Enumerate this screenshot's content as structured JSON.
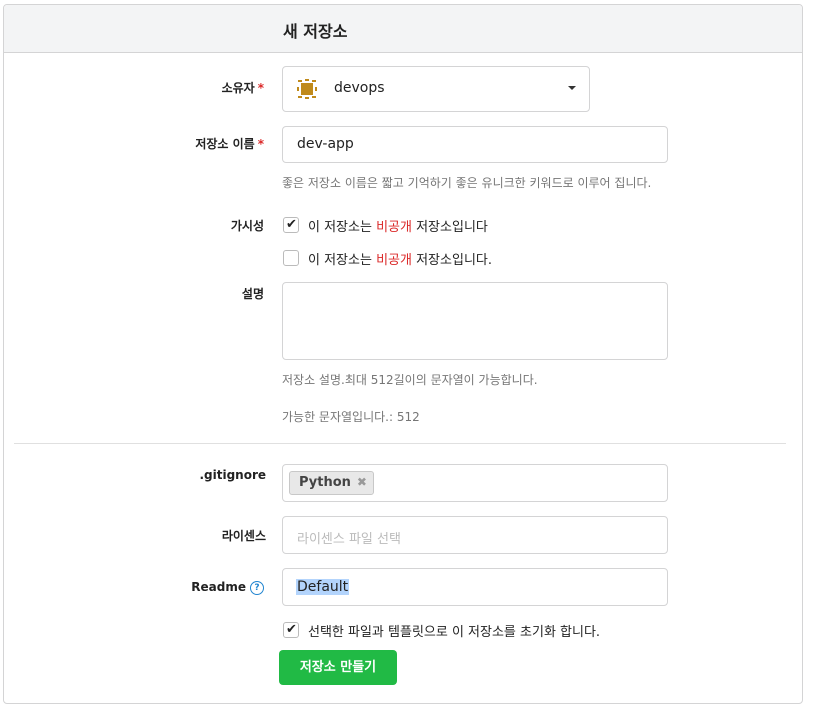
{
  "header": {
    "title": "새 저장소"
  },
  "owner": {
    "label": "소유자",
    "value": "devops",
    "avatar_color": "#c08a1a"
  },
  "repo_name": {
    "label": "저장소 이름",
    "value": "dev-app",
    "help": "좋은 저장소 이름은 짧고 기억하기 좋은 유니크한 키워드로 이루어 집니다."
  },
  "visibility": {
    "label": "가시성",
    "options": [
      {
        "prefix": "이 저장소는 ",
        "highlight": "비공개",
        "suffix": " 저장소입니다",
        "checked": true
      },
      {
        "prefix": "이 저장소는 ",
        "highlight": "비공개",
        "suffix": " 저장소입니다.",
        "checked": false
      }
    ]
  },
  "description": {
    "label": "설명",
    "value": "",
    "help": "저장소 설명.최대 512길이의 문자열이 가능합니다.",
    "remaining": "가능한 문자열입니다.: 512"
  },
  "gitignore": {
    "label": ".gitignore",
    "tags": [
      "Python"
    ]
  },
  "license": {
    "label": "라이센스",
    "placeholder": "라이센스 파일 선택"
  },
  "readme": {
    "label": "Readme",
    "value": "Default",
    "help_icon": "question-circle-icon"
  },
  "init": {
    "text": "선택한 파일과 템플릿으로 이 저장소를 초기화 합니다.",
    "checked": true
  },
  "submit": {
    "label": "저장소 만들기"
  },
  "colors": {
    "required": "#db2828",
    "button": "#21ba45",
    "help_icon": "#2185d0"
  }
}
